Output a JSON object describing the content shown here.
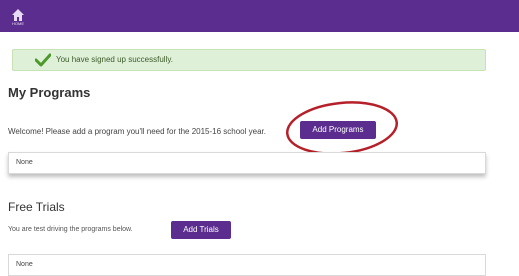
{
  "header": {
    "home_icon": "home-icon",
    "home_label": "HOME",
    "brand_color": "#5b2d8e"
  },
  "alert": {
    "icon": "checkmark-icon",
    "message": "You have signed up successfully.",
    "color": "#dff0d8"
  },
  "programs": {
    "heading": "My Programs",
    "welcome_text": "Welcome! Please add a program you'll need for the 2015-16 school year.",
    "add_button": "Add Programs",
    "list_value": "None",
    "annotation_color": "#b5212a"
  },
  "trials": {
    "heading": "Free Trials",
    "text": "You are test driving the programs below.",
    "add_button": "Add Trials",
    "list_value": "None"
  }
}
